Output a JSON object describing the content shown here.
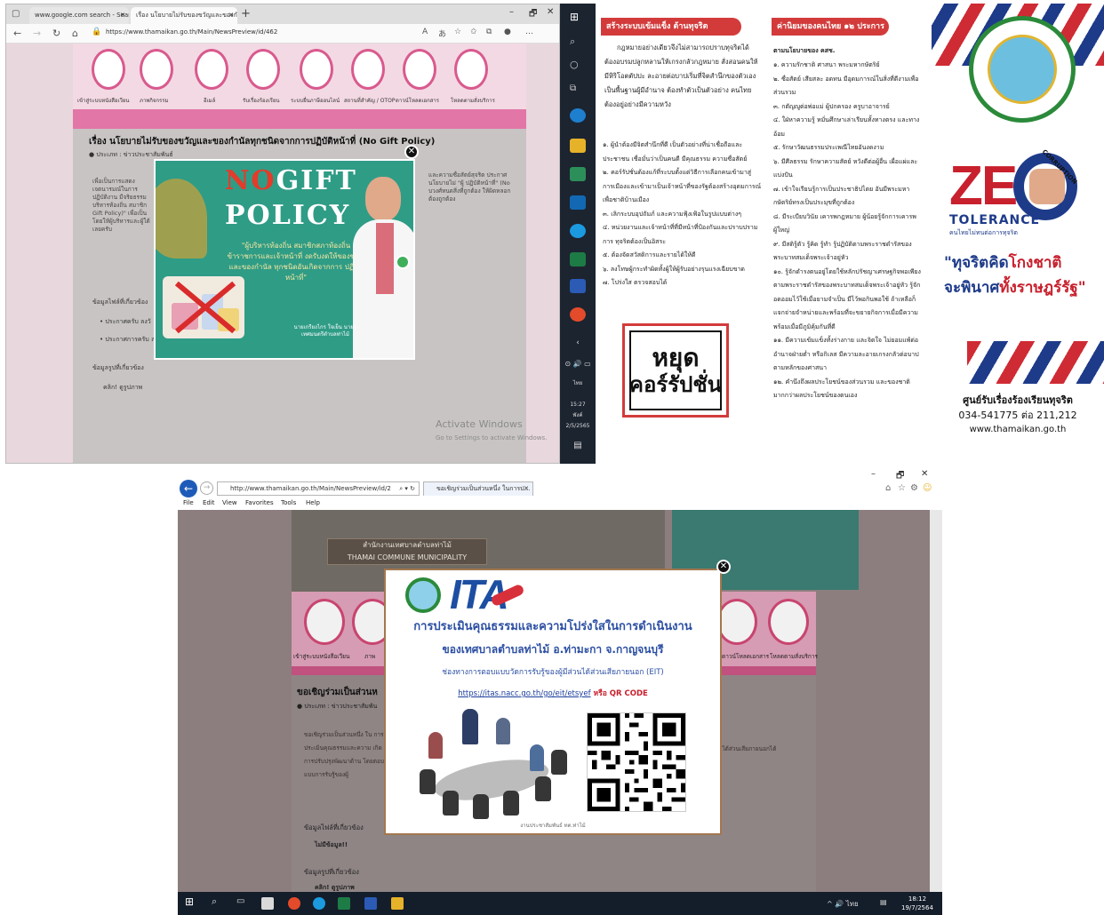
{
  "edge_window": {
    "tabs": [
      {
        "label": "www.google.com search - Search"
      },
      {
        "label": "เรื่อง นโยบายไม่รับของขวัญและของกำนัล"
      }
    ],
    "window_controls": {
      "minimize": "–",
      "maximize": "🗗",
      "close": "✕"
    },
    "url": "https://www.thamaikan.go.th/Main/NewsPreview/id/462",
    "nav_labels": [
      "เข้าสู่ระบบหนังสือเวียน",
      "ภาพกิจกรรม",
      "อีเมล์",
      "รับเรื่องร้องเรียน",
      "ระบบยื่นภาษีออนไลน์",
      "สถานที่สำคัญ / OTOP",
      "ดาวน์โหลดเอกสาร",
      "โหลดตามสั่งบริการ"
    ],
    "page_title": "เรื่อง นโยบายไม่รับของขวัญและของกำนัลทุกชนิดจากการปฏิบัติหน้าที่ (No Gift Policy)",
    "meta": "ประเภท : ข่าวประชาสัมพันธ์",
    "body_left": "เพื่อเป็นการแสดงเจตนารมณ์ในการปฏิบัติงาน มีจริยธรรม บริหารท้องถิ่น สมาชิก Gift Policy)\" เพื่อเป็น โดยให้ผู้บริหารและผู้ใต้ เลยครับ",
    "body_right": "และความซื่อสัตย์สุจริต ประกาศนโยบายไม่ \"ผู้ ปฏิบัติหน้าที่\" (No บวงศ์หนดสิ่งที่ถูกต้อง ให้ผิดหลอกต้องถูกต้อง",
    "section_files": "ข้อมูลไฟล์ที่เกี่ยวข้อง",
    "files": [
      "ประกาศครับ ลงวั",
      "ประกาศการครับ ล"
    ],
    "section_photos": "ข้อมูลรูปที่เกี่ยวข้อง",
    "photos_link": "คลิก! ดูรูปภาพ",
    "activate_title": "Activate Windows",
    "activate_sub": "Go to Settings to activate Windows.",
    "popup": {
      "line1_no": "NO",
      "line1_rest": "GIFT",
      "line2": "POLICY",
      "quote": "\"ผู้บริหารท้องถิ่น สมาชิกสภาท้องถิ่น ข้าราชการและเจ้าหน้าที่ งดรับงดให้ของขวัญและของกำนัล ทุกชนิดอันเกิดจากการ ปฏิบัติหน้าที่\"",
      "signature": "นายเกรียงไกร ใจเย็น นายกเทศมนตรีตำบลท่าไม้",
      "close": "✕"
    }
  },
  "taskbar_vertical": {
    "time": "15:27",
    "day": "พังค์",
    "date": "2/5/2565",
    "lang": "ไทย"
  },
  "infographic": {
    "left_header": "สร้างระบบเข้มแข็ง ต้านทุจริต",
    "left_para": "กฎหมายอย่างเดียวจึงไม่สามารถปราบทุจริตได้ ต้องอบรมปลูกหลานให้เกรงกลัวกฎหมาย สั่งสอนคนให้มีหิริโอตตัปปะ ละอายต่อบาปเริ่มที่จิตสำนึกของตัวเองเป็นพื้นฐานผู้มีอำนาจ ต้องทำตัวเป็นตัวอย่าง คนไทยต้องอยู่อย่างมีความหวัง",
    "left_list": [
      "๑. ผู้นำต้องมีจิตสำนึกที่ดี เป็นตัวอย่างที่น่าเชื่อถือและประชาชน เชื่อมั่นว่าเป็นคนดี มีคุณธรรม ความซื่อสัตย์",
      "๒. คอร์รัปชั่นต้องแก้ที่ระบบตั้งแต่วิธีการเลือกคนเข้ามาสู่การเมืองและเข้ามาเป็นเจ้าหน้าที่ของรัฐต้องสร้างอุดมการณ์ เพื่อชาติบ้านเมือง",
      "๓. เลิกระบบอุปถัมภ์ และความฟุ้งเฟ้อในรูปแบบต่างๆ",
      "๔. หน่วยงานและเจ้าหน้าที่ที่มีหน้าที่ป้องกันและปราบปรามการ ทุจริตต้องเป็นอิสระ",
      "๕. ต้องจัดสวัสดิการและรายได้ให้ดี",
      "๖. ลงโทษผู้กระทำผิดทั้งผู้ให้ผู้รับอย่างรุนแรงเฉียบขาด",
      "๗. โปร่งใส ตรวจสอบได้"
    ],
    "stop_word1": "หยุด",
    "stop_word2": "คอร์รัปชั่น",
    "right_header": "ค่านิยมของคนไทย ๑๒ ประการ",
    "right_sub": "ตามนโยบายของ คสช.",
    "right_list": [
      "๑. ความรักชาติ ศาสนา พระมหากษัตริย์",
      "๒. ซื่อสัตย์ เสียสละ อดทน มีอุดมการณ์ในสิ่งที่ดีงามเพื่อส่วนรวม",
      "๓. กตัญญูต่อพ่อแม่ ผู้ปกครอง ครูบาอาจารย์",
      "๔. ใฝ่หาความรู้ หมั่นศึกษาเล่าเรียนทั้งทางตรง และทางอ้อม",
      "๕. รักษาวัฒนธรรมประเพณีไทยอันงดงาม",
      "๖. มีศีลธรรม รักษาความสัตย์ หวังดีต่อผู้อื่น เผื่อแผ่และแบ่งปัน",
      "๗. เข้าใจเรียนรู้การเป็นประชาธิปไตย อันมีพระมหากษัตริย์ทรงเป็นประมุขที่ถูกต้อง",
      "๘. มีระเบียบวินัย เคารพกฎหมาย ผู้น้อยรู้จักการเคารพผู้ใหญ่",
      "๙. มีสติรู้ตัว รู้คิด รู้ทำ รู้ปฏิบัติตามพระราชดำรัสของพระบาทสมเด็จพระเจ้าอยู่หัว",
      "๑๐. รู้จักดำรงตนอยู่โดยใช้หลักปรัชญาเศรษฐกิจพอเพียงตามพระราชดำรัสของพระบาทสมเด็จพระเจ้าอยู่หัว รู้จักอดออมไว้ใช้เมื่อยามจำเป็น มีไว้พอกินพอใช้ ถ้าเหลือก็แจกจ่ายจำหน่ายและพร้อมที่จะขยายกิจการเมื่อมีความพร้อมเมื่อมีภูมิคุ้มกันที่ดี",
      "๑๑. มีความเข้มแข็งทั้งร่างกาย และจิตใจ ไม่ยอมแพ้ต่ออำนาจฝ่ายต่ำ หรือกิเลส มีความละอายเกรงกลัวต่อบาปตามหลักของศาสนา",
      "๑๒. คำนึงถึงผลประโยชน์ของส่วนรวม และของชาติมากกว่าผลประโยชน์ของตนเอง"
    ]
  },
  "poster": {
    "zero": "ZER",
    "corruption": "CORRUPTION",
    "tolerance": "TOLERANCE",
    "tolerance_sub": "คนไทยไม่ทนต่อการทุจริต",
    "slogan_a": "\"ทุจริตคิด",
    "slogan_b": "โกงชาติ",
    "slogan_c": "จะพินาศ",
    "slogan_d": "ทั้งราษฎร์รัฐ\"",
    "center_title": "ศูนย์รับเรื่องร้องเรียนทุจริต",
    "phone": "034-541775 ต่อ 211,212",
    "website": "www.thamaikan.go.th"
  },
  "ie_window": {
    "address": "http://www.thamaikan.go.th/Main/NewsPreview/id/2",
    "tab_label": "ขอเชิญร่วมเป็นส่วนหนึ่ง ในการป...",
    "window_controls": {
      "minimize": "–",
      "maximize": "🗗",
      "close": "✕"
    },
    "menu": [
      "File",
      "Edit",
      "View",
      "Favorites",
      "Tools",
      "Help"
    ],
    "sign_line1": "สำนักงานเทศบาลตำบลท่าไม้",
    "sign_line2": "THAMAI COMMUNE MUNICIPALITY",
    "nav_labels": [
      "เข้าสู่ระบบหนังสือเวียน",
      "ภาพ",
      "ดาวน์โหลดเอกสาร",
      "โหลดตามสั่งบริการ"
    ],
    "content_title": "ขอเชิญร่วมเป็นส่วนห",
    "content_meta": "ประเภท : ข่าวประชาสัมพัน",
    "content_para": "ขอเชิญร่วมเป็นส่วนหนึ่ง ใน การประเมินคุณธรรมและความ เกิดการปรับปรุงพัฒนาด้าน โดยตอบแบบการรับรู้ของผู้",
    "content_right": "มีส่วนได้ส่วนเสียภายนอกได้",
    "section_files": "ข้อมูลไฟล์ที่เกี่ยวข้อง",
    "no_data": "ไม่มีข้อมูล!!",
    "section_photos": "ข้อมูลรูปที่เกี่ยวข้อง",
    "photos_link": "คลิก! ดูรูปภาพ",
    "popup": {
      "ita": "ITA",
      "line1": "การประเมินคุณธรรมและความโปร่งใสในการดำเนินงาน",
      "line2": "ของเทศบาลตำบลท่าไม้  อ.ท่ามะกา  จ.กาญจนบุรี",
      "line3": "ช่องทางการตอบแบบวัดการรับรู้ของผู้มีส่วนได้ส่วนเสียภายนอก (EIT)",
      "link": "https://itas.nacc.go.th/go/eit/etsyef",
      "or_qr": " หรือ QR CODE",
      "footer": "งานประชาสัมพันธ์ ทต.ท่าไม้",
      "close": "✕"
    }
  },
  "taskbar_horizontal": {
    "tray": "^ 🔊 ไทย",
    "time": "18:12",
    "date": "19/7/2564"
  }
}
